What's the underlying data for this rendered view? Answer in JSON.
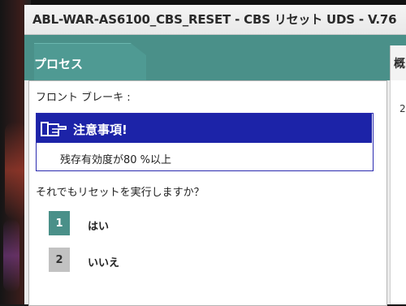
{
  "window": {
    "title": "ABL-WAR-AS6100_CBS_RESET - CBS リセット UDS - V.76"
  },
  "tabs": {
    "active_label": "プロセス",
    "right_label": "概"
  },
  "side_panel": {
    "number": "2"
  },
  "content": {
    "section_label": "フロント ブレーキ :",
    "warning": {
      "icon": "pointing-hand-icon",
      "title": "注意事項!",
      "message": "残存有効度が80 %以上"
    },
    "question": "それでもリセットを実行しますか？",
    "options": [
      {
        "number": "1",
        "label": "はい"
      },
      {
        "number": "2",
        "label": "いいえ"
      }
    ]
  },
  "colors": {
    "accent_teal": "#4a9089",
    "warning_blue": "#1c23a8"
  }
}
